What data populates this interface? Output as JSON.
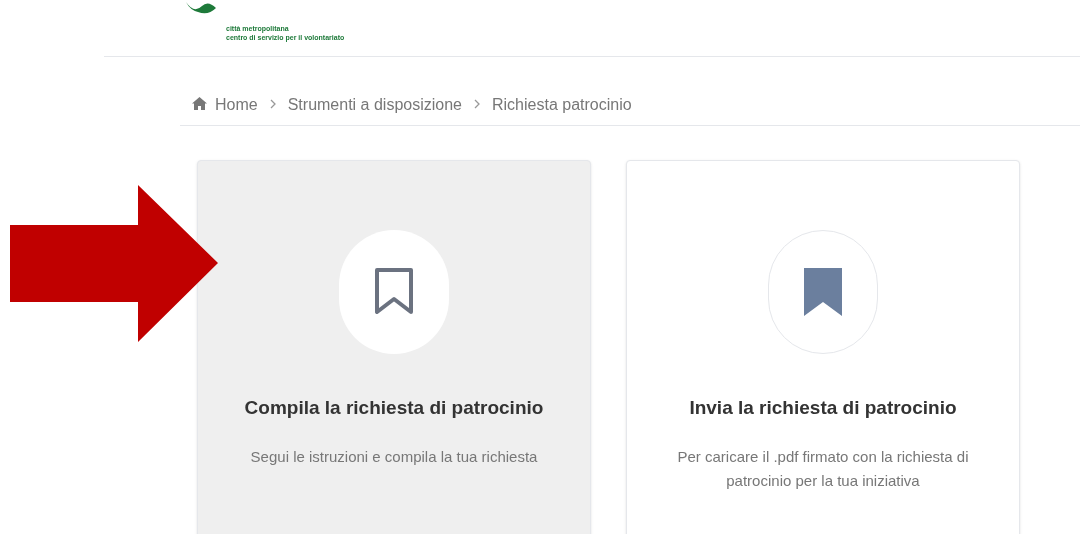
{
  "header": {
    "logo_lines": [
      "città metropolitana",
      "centro di servizio per il volontariato"
    ]
  },
  "breadcrumb": [
    "Home",
    "Strumenti a disposizione",
    "Richiesta patrocinio"
  ],
  "cards": [
    {
      "title": "Compila la richiesta di patrocinio",
      "description": "Segui le istruzioni e compila la tua richiesta",
      "selected": true
    },
    {
      "title": "Invia la richiesta di patrocinio",
      "description": "Per caricare il .pdf firmato con la richiesta di patrocinio per la tua iniziativa",
      "selected": false
    }
  ]
}
